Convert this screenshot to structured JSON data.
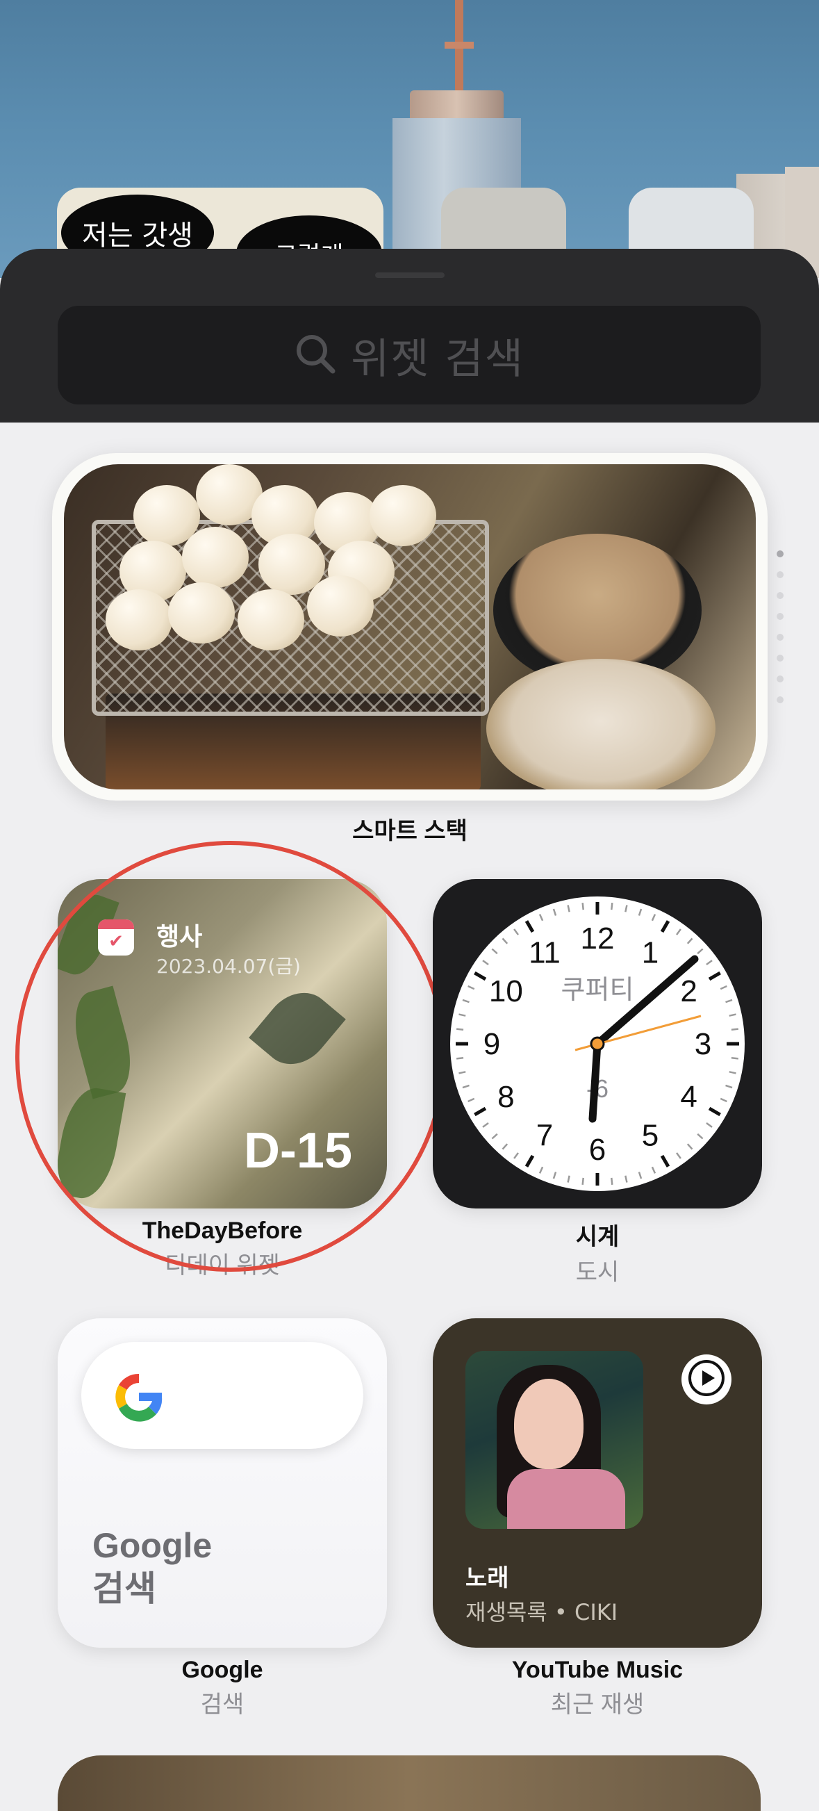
{
  "search": {
    "placeholder": "위젯 검색"
  },
  "home_preview": {
    "sticker_1": "저는 갓생",
    "sticker_2": "그렇게"
  },
  "smart_stack": {
    "title": "스마트 스택"
  },
  "widgets": [
    {
      "id": "thedaybefore",
      "name": "TheDayBefore",
      "subtitle": "디데이 위젯",
      "event_title": "행사",
      "event_date": "2023.04.07(금)",
      "countdown": "D-15"
    },
    {
      "id": "clock",
      "name": "시계",
      "subtitle": "도시",
      "city": "쿠퍼티",
      "offset": "-6",
      "numbers": [
        "12",
        "1",
        "2",
        "3",
        "4",
        "5",
        "6",
        "7",
        "8",
        "9",
        "10",
        "11"
      ]
    },
    {
      "id": "google",
      "name": "Google",
      "subtitle": "검색",
      "label_line1": "Google",
      "label_line2": "검색"
    },
    {
      "id": "youtube_music",
      "name": "YouTube Music",
      "subtitle": "최근 재생",
      "track_title": "노래",
      "track_sub": "재생목록 • CIKI"
    }
  ],
  "colors": {
    "highlight_circle": "#e04a3e",
    "calendar_red": "#e5566a",
    "clock_second_hand": "#f29d38"
  }
}
